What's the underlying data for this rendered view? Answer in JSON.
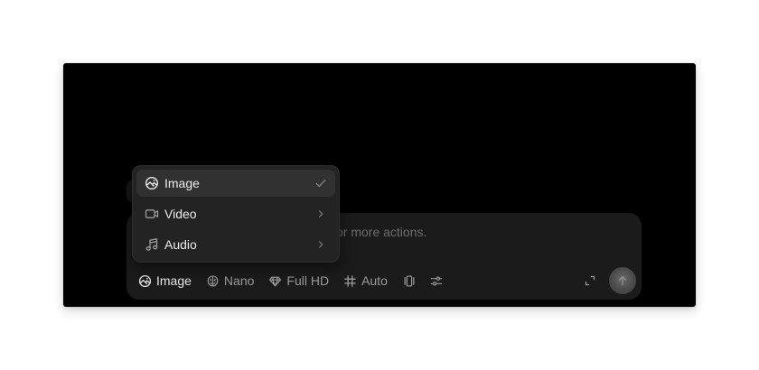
{
  "composer": {
    "placeholder_visible": "or more actions."
  },
  "toolbar": {
    "mode_label": "Image",
    "model_label": "Nano",
    "quality_label": "Full HD",
    "aspect_label": "Auto"
  },
  "menu": {
    "items": [
      {
        "label": "Image",
        "icon": "image-icon",
        "trailing": "check-icon",
        "selected": true
      },
      {
        "label": "Video",
        "icon": "video-icon",
        "trailing": "chevron-right-icon",
        "selected": false
      },
      {
        "label": "Audio",
        "icon": "music-note-icon",
        "trailing": "chevron-right-icon",
        "selected": false
      }
    ]
  },
  "colors": {
    "stage_bg": "#000000",
    "composer_bg": "#1b1b1b",
    "menu_bg": "#232323",
    "menu_selected_bg": "#313131",
    "text_primary": "#ececec",
    "text_muted": "#9a9a9a"
  }
}
